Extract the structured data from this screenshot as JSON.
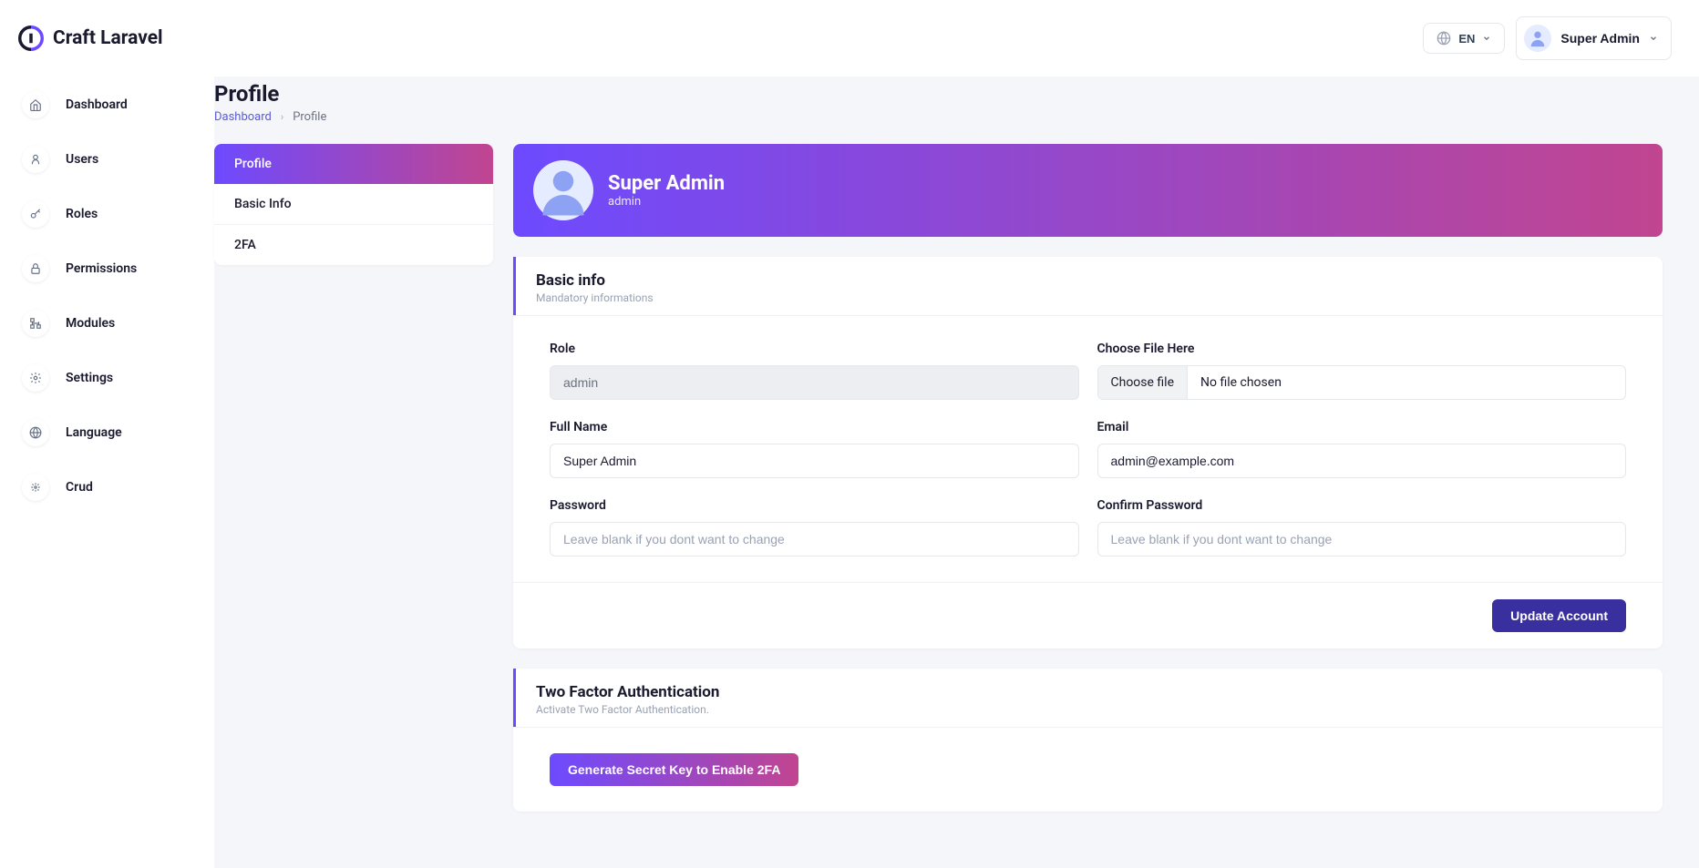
{
  "brand": "Craft Laravel",
  "header": {
    "lang": "EN",
    "user_name": "Super Admin"
  },
  "sidebar": {
    "items": [
      {
        "label": "Dashboard",
        "icon": "home"
      },
      {
        "label": "Users",
        "icon": "user"
      },
      {
        "label": "Roles",
        "icon": "key"
      },
      {
        "label": "Permissions",
        "icon": "lock"
      },
      {
        "label": "Modules",
        "icon": "tree"
      },
      {
        "label": "Settings",
        "icon": "gear"
      },
      {
        "label": "Language",
        "icon": "globe"
      },
      {
        "label": "Crud",
        "icon": "sparkle"
      }
    ]
  },
  "page": {
    "title": "Profile",
    "breadcrumb_root": "Dashboard",
    "breadcrumb_current": "Profile"
  },
  "tabs": {
    "profile": "Profile",
    "basic_info": "Basic Info",
    "twofa": "2FA"
  },
  "hero": {
    "name": "Super Admin",
    "role": "admin"
  },
  "basic_info": {
    "title": "Basic info",
    "subtitle": "Mandatory informations",
    "labels": {
      "role": "Role",
      "choose_file": "Choose File Here",
      "full_name": "Full Name",
      "email": "Email",
      "password": "Password",
      "confirm_password": "Confirm Password"
    },
    "values": {
      "role": "admin",
      "full_name": "Super Admin",
      "email": "admin@example.com"
    },
    "file_button": "Choose file",
    "file_placeholder": "No file chosen",
    "password_placeholder": "Leave blank if you dont want to change",
    "submit": "Update Account"
  },
  "twofa_card": {
    "title": "Two Factor Authentication",
    "subtitle": "Activate Two Factor Authentication.",
    "button": "Generate Secret Key to Enable 2FA"
  }
}
